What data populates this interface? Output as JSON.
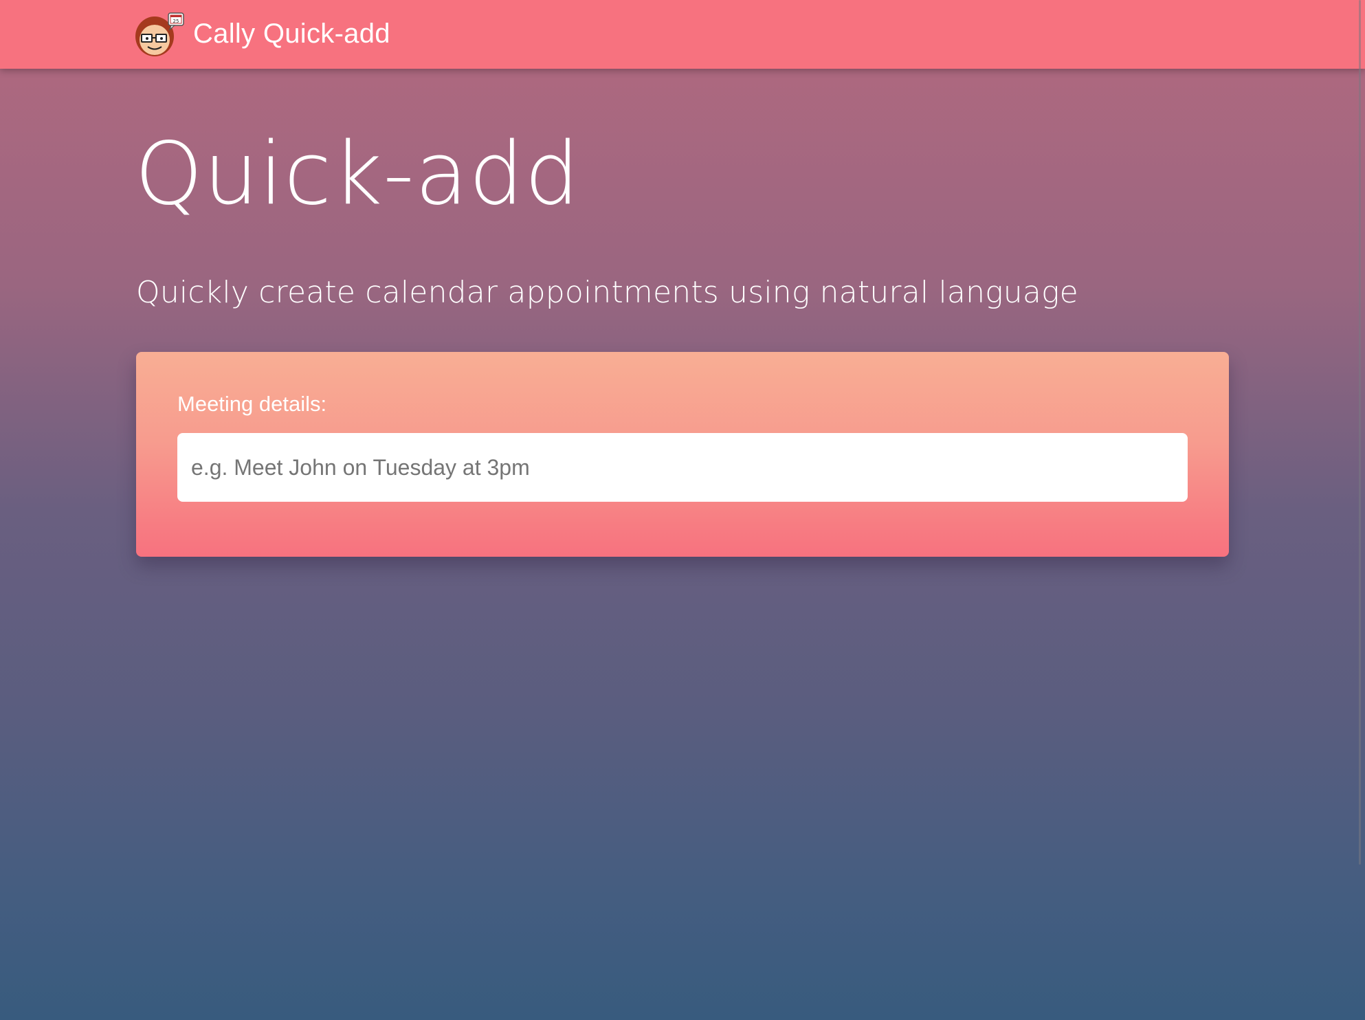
{
  "header": {
    "app_title": "Cally Quick-add",
    "logo_icon": "cartoon-face-logo-icon",
    "logo_badge_text": "25"
  },
  "main": {
    "title": "Quick-add",
    "subtitle": "Quickly create calendar appointments using natural language"
  },
  "form": {
    "meeting_label": "Meeting details:",
    "meeting_value": "",
    "meeting_placeholder": "e.g. Meet John on Tuesday at 3pm"
  },
  "colors": {
    "navbar": "#f7727f",
    "card_top": "#f8ae94",
    "card_bottom": "#f7727f",
    "background_top": "#b3697f",
    "background_bottom": "#385b7e"
  }
}
